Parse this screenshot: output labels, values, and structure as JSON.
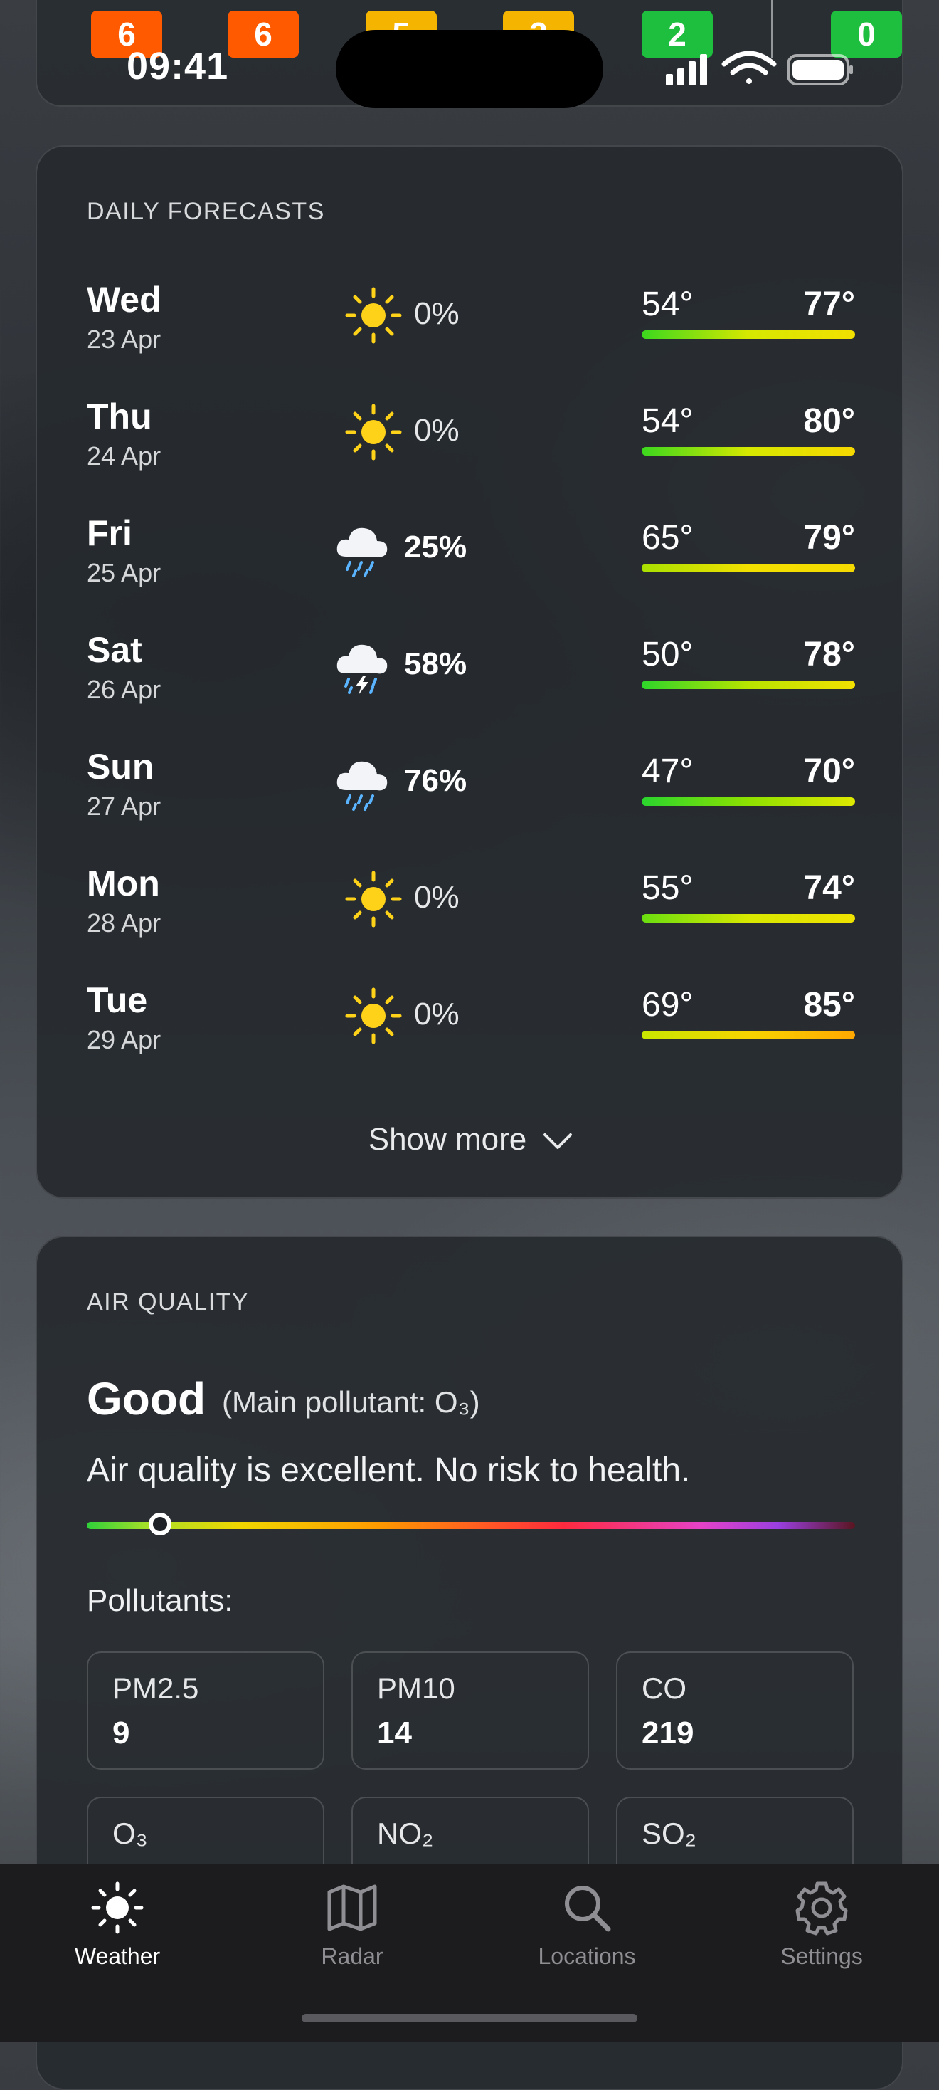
{
  "status_bar": {
    "time": "09:41"
  },
  "hourly_badges": [
    {
      "value": "6",
      "color": "#ff5a00"
    },
    {
      "value": "6",
      "color": "#ff5a00"
    },
    {
      "value": "5",
      "color": "#f5b400"
    },
    {
      "value": "3",
      "color": "#f5b400"
    },
    {
      "value": "2",
      "color": "#1ebe3e"
    },
    {
      "value": "0",
      "color": "#1ebe3e"
    }
  ],
  "daily": {
    "title": "DAILY FORECASTS",
    "days": [
      {
        "day": "Wed",
        "date": "23 Apr",
        "icon": "sun-icon",
        "precip": "0%",
        "min": "54°",
        "max": "77°",
        "bar": "linear-gradient(90deg,#3bd71e,#d6e800,#f2e000)"
      },
      {
        "day": "Thu",
        "date": "24 Apr",
        "icon": "sun-icon",
        "precip": "0%",
        "min": "54°",
        "max": "80°",
        "bar": "linear-gradient(90deg,#3bd71e,#d6e800,#f6d800)"
      },
      {
        "day": "Fri",
        "date": "25 Apr",
        "icon": "rain-cloud-icon",
        "precip": "25%",
        "min": "65°",
        "max": "79°",
        "bar": "linear-gradient(90deg,#a8e000,#f2e000,#f4da00)"
      },
      {
        "day": "Sat",
        "date": "26 Apr",
        "icon": "thunderstorm-icon",
        "precip": "58%",
        "min": "50°",
        "max": "78°",
        "bar": "linear-gradient(90deg,#2ed62a,#b8e400,#f2e000)"
      },
      {
        "day": "Sun",
        "date": "27 Apr",
        "icon": "rain-cloud-icon",
        "precip": "76%",
        "min": "47°",
        "max": "70°",
        "bar": "linear-gradient(90deg,#2ad52e,#8ee000,#dfe800)"
      },
      {
        "day": "Mon",
        "date": "28 Apr",
        "icon": "sun-icon",
        "precip": "0%",
        "min": "55°",
        "max": "74°",
        "bar": "linear-gradient(90deg,#6ade10,#d8e800,#efe200)"
      },
      {
        "day": "Tue",
        "date": "29 Apr",
        "icon": "sun-icon",
        "precip": "0%",
        "min": "69°",
        "max": "85°",
        "bar": "linear-gradient(90deg,#c8e800,#f6d400,#ffa800)"
      }
    ],
    "show_more": "Show more"
  },
  "air_quality": {
    "title": "AIR QUALITY",
    "rating": "Good",
    "main_pollutant": "(Main pollutant: O₃)",
    "description": "Air quality is excellent. No risk to health.",
    "scale_position": 0.095,
    "pollutants_label": "Pollutants:",
    "pollutants": [
      {
        "name": "PM2.5",
        "value": "9"
      },
      {
        "name": "PM10",
        "value": "14"
      },
      {
        "name": "CO",
        "value": "219"
      },
      {
        "name": "O₃",
        "value": ""
      },
      {
        "name": "NO₂",
        "value": ""
      },
      {
        "name": "SO₂",
        "value": ""
      }
    ]
  },
  "tabs": [
    {
      "label": "Weather",
      "icon": "sun-icon",
      "active": true
    },
    {
      "label": "Radar",
      "icon": "map-icon",
      "active": false
    },
    {
      "label": "Locations",
      "icon": "search-icon",
      "active": false
    },
    {
      "label": "Settings",
      "icon": "gear-icon",
      "active": false
    }
  ]
}
